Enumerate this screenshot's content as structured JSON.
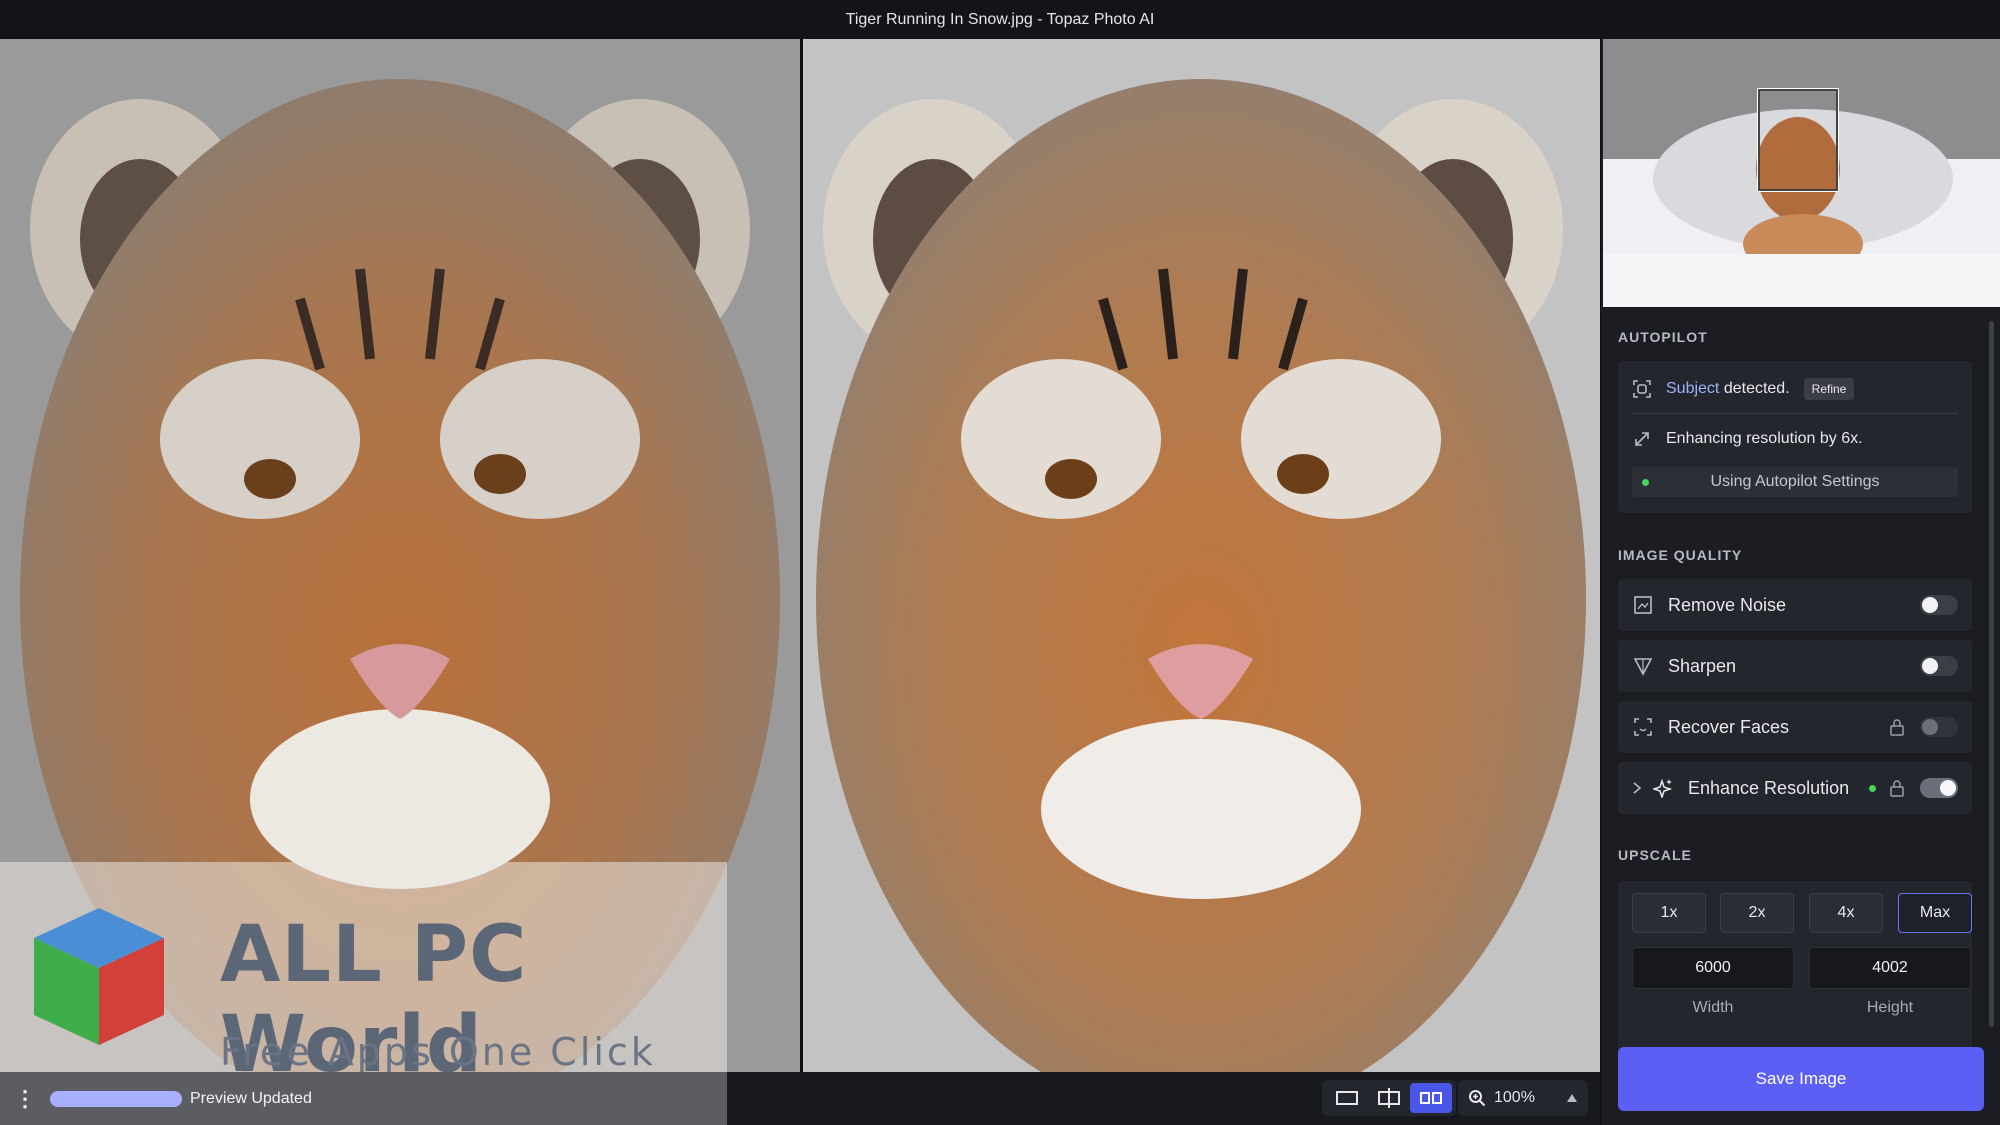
{
  "window": {
    "title": "Tiger Running In Snow.jpg - Topaz Photo AI"
  },
  "watermark": {
    "title": "ALL PC World",
    "subtitle": "Free Apps One Click Away"
  },
  "bottombar": {
    "status": "Preview Updated",
    "zoom": "100%",
    "views": [
      "single-view-icon",
      "split-view-icon",
      "side-by-side-view-icon"
    ],
    "active_view": "side-by-side"
  },
  "autopilot": {
    "heading": "AUTOPILOT",
    "subject_word": "Subject",
    "subject_rest": " detected.",
    "refine_label": "Refine",
    "enhancing_text": "Enhancing resolution by 6x.",
    "settings_label": "Using Autopilot Settings"
  },
  "image_quality": {
    "heading": "IMAGE QUALITY",
    "items": [
      {
        "label": "Remove Noise",
        "enabled": false,
        "locked": false
      },
      {
        "label": "Sharpen",
        "enabled": false,
        "locked": false
      },
      {
        "label": "Recover Faces",
        "enabled": false,
        "locked": true
      },
      {
        "label": "Enhance Resolution",
        "enabled": true,
        "locked": true
      }
    ]
  },
  "upscale": {
    "heading": "UPSCALE",
    "options": [
      "1x",
      "2x",
      "4x",
      "Max"
    ],
    "selected": "Max",
    "width_value": "6000",
    "height_value": "4002",
    "width_label": "Width",
    "height_label": "Height"
  },
  "save_label": "Save Image",
  "colors": {
    "accent": "#5b5ff4",
    "active_dot": "#48d45a",
    "link": "#9fb0ff"
  }
}
